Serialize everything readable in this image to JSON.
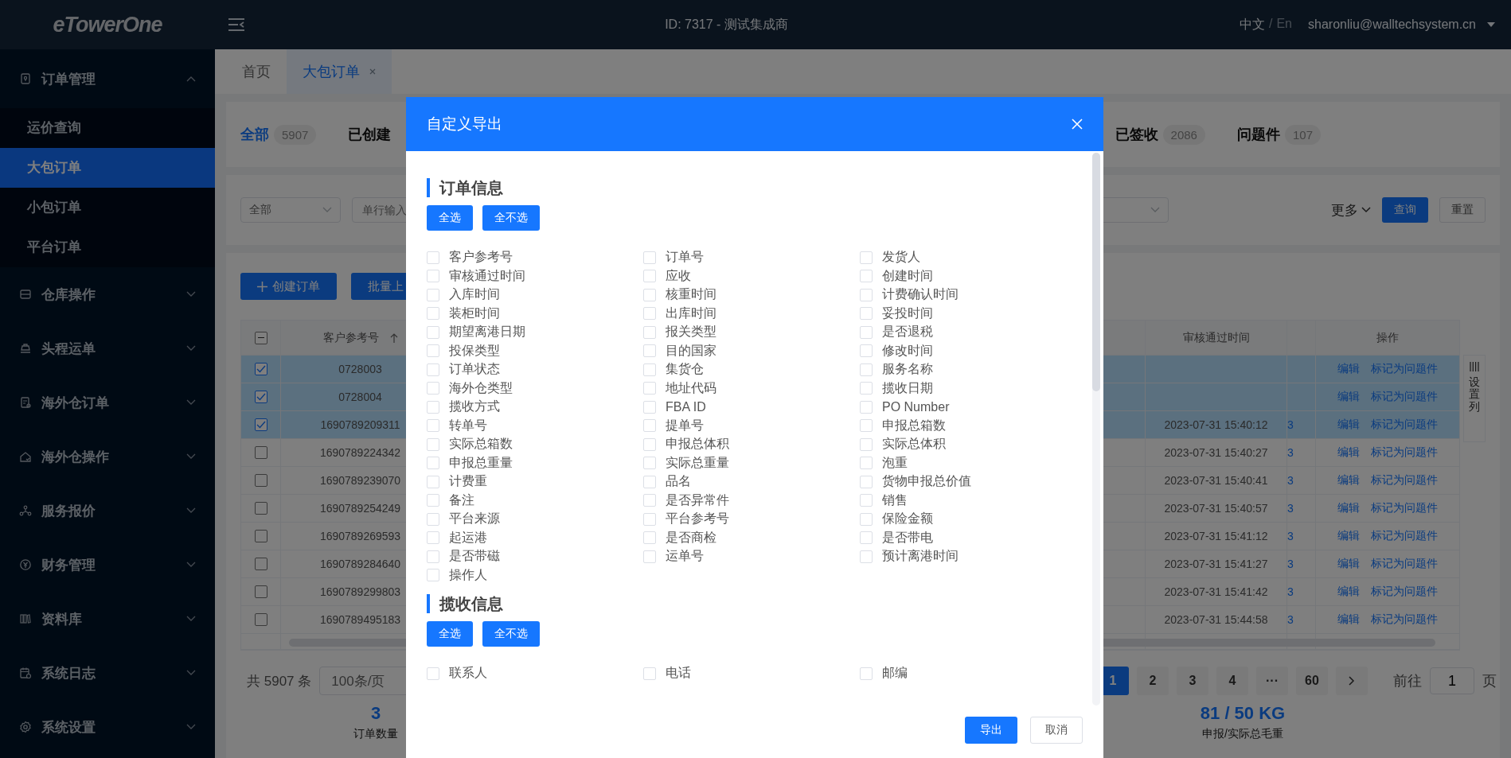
{
  "header": {
    "logo": "eTowerOne",
    "account": "ID: 7317 - 测试集成商",
    "language": [
      {
        "label": "中文",
        "selected": true
      },
      {
        "label": "En",
        "selected": false
      }
    ],
    "language_separator": "/",
    "user": "sharonliu@walltechsystem.cn"
  },
  "sidebar": {
    "items": [
      {
        "label": "订单管理",
        "expanded": true,
        "children": [
          {
            "label": "运价查询",
            "selected": false
          },
          {
            "label": "大包订单",
            "selected": true
          },
          {
            "label": "小包订单",
            "selected": false
          },
          {
            "label": "平台订单",
            "selected": false
          }
        ]
      },
      {
        "label": "仓库操作",
        "expanded": false
      },
      {
        "label": "头程运单",
        "expanded": false
      },
      {
        "label": "海外仓订单",
        "expanded": false
      },
      {
        "label": "海外仓操作",
        "expanded": false
      },
      {
        "label": "服务报价",
        "expanded": false
      },
      {
        "label": "财务管理",
        "expanded": false
      },
      {
        "label": "资料库",
        "expanded": false
      },
      {
        "label": "系统日志",
        "expanded": false
      },
      {
        "label": "系统设置",
        "expanded": false
      }
    ]
  },
  "tabs": [
    {
      "label": "首页",
      "selected": false,
      "closable": false
    },
    {
      "label": "大包订单",
      "selected": true,
      "closable": true
    }
  ],
  "status_tabs": [
    {
      "label": "全部",
      "count": "5907",
      "selected": true
    },
    {
      "label": "已创建",
      "selected": false
    },
    {
      "label": "已签收",
      "count": "2086",
      "selected": false
    },
    {
      "label": "问题件",
      "count": "107",
      "selected": false
    }
  ],
  "filters": {
    "scope": "全部",
    "search_placeholder": "单行输入",
    "more": "更多",
    "query": "查询",
    "reset": "重置"
  },
  "actions": [
    "创建订单",
    "批量上"
  ],
  "table": {
    "header_checkbox_indeterminate": true,
    "columns": [
      "客户参考号",
      "审核通过时间",
      "操作"
    ],
    "rows": [
      {
        "selected": true,
        "customer_ref": "0728003",
        "actions": [
          "编辑",
          "标记为问题件"
        ]
      },
      {
        "selected": true,
        "customer_ref": "0728004",
        "actions": [
          "编辑",
          "标记为问题件"
        ]
      },
      {
        "selected": true,
        "customer_ref": "1690789209311",
        "approved_at": "2023-07-31 15:40:12",
        "column_4": "3",
        "actions": [
          "编辑",
          "标记为问题件"
        ]
      },
      {
        "selected": false,
        "customer_ref": "1690789224342",
        "approved_at": "2023-07-31 15:40:27",
        "column_4": "3",
        "actions": [
          "编辑",
          "标记为问题件"
        ]
      },
      {
        "selected": false,
        "customer_ref": "1690789239070",
        "approved_at": "2023-07-31 15:40:41",
        "column_4": "3",
        "actions": [
          "编辑",
          "标记为问题件"
        ]
      },
      {
        "selected": false,
        "customer_ref": "1690789254249",
        "approved_at": "2023-07-31 15:40:57",
        "column_4": "3",
        "actions": [
          "编辑",
          "标记为问题件"
        ]
      },
      {
        "selected": false,
        "customer_ref": "1690789269593",
        "approved_at": "2023-07-31 15:41:12",
        "column_4": "3",
        "actions": [
          "编辑",
          "标记为问题件"
        ]
      },
      {
        "selected": false,
        "customer_ref": "1690789284640",
        "approved_at": "2023-07-31 15:41:27",
        "column_4": "3",
        "actions": [
          "编辑",
          "标记为问题件"
        ]
      },
      {
        "selected": false,
        "customer_ref": "1690789299803",
        "approved_at": "2023-07-31 15:41:42",
        "column_4": "3",
        "actions": [
          "编辑",
          "标记为问题件"
        ]
      },
      {
        "selected": false,
        "customer_ref": "1690789495183",
        "approved_at": "2023-07-31 15:44:58",
        "column_4": "3",
        "actions": [
          "编辑",
          "标记为问题件"
        ]
      }
    ],
    "column_settings": "设置列"
  },
  "pagination": {
    "total": "共 5907 条",
    "page_size": "100条/页",
    "pages": [
      {
        "label": "1",
        "selected": true
      },
      {
        "label": "2",
        "selected": false
      },
      {
        "label": "3",
        "selected": false
      },
      {
        "label": "4",
        "selected": false
      },
      {
        "label": "···",
        "selected": false
      },
      {
        "label": "60",
        "selected": false
      }
    ],
    "goto_label": "前往",
    "goto_value": "1",
    "goto_suffix": "页"
  },
  "summary": [
    {
      "value": "3",
      "label": "订单数量"
    },
    {
      "value": "81 / 50 KG",
      "label": "申报/实际总毛重"
    }
  ],
  "dialog": {
    "title": "自定义导出",
    "sections": [
      {
        "title": "订单信息",
        "select_all": "全选",
        "select_none": "全不选",
        "fields": [
          {
            "label": "客户参考号",
            "checked": false
          },
          {
            "label": "订单号",
            "checked": false
          },
          {
            "label": "发货人",
            "checked": false
          },
          {
            "label": "审核通过时间",
            "checked": false
          },
          {
            "label": "应收",
            "checked": false
          },
          {
            "label": "创建时间",
            "checked": false
          },
          {
            "label": "入库时间",
            "checked": false
          },
          {
            "label": "核重时间",
            "checked": false
          },
          {
            "label": "计费确认时间",
            "checked": false
          },
          {
            "label": "装柜时间",
            "checked": false
          },
          {
            "label": "出库时间",
            "checked": false
          },
          {
            "label": "妥投时间",
            "checked": false
          },
          {
            "label": "期望离港日期",
            "checked": false
          },
          {
            "label": "报关类型",
            "checked": false
          },
          {
            "label": "是否退税",
            "checked": false
          },
          {
            "label": "投保类型",
            "checked": false
          },
          {
            "label": "目的国家",
            "checked": false
          },
          {
            "label": "修改时间",
            "checked": false
          },
          {
            "label": "订单状态",
            "checked": false
          },
          {
            "label": "集货仓",
            "checked": false
          },
          {
            "label": "服务名称",
            "checked": false
          },
          {
            "label": "海外仓类型",
            "checked": false
          },
          {
            "label": "地址代码",
            "checked": false
          },
          {
            "label": "揽收日期",
            "checked": false
          },
          {
            "label": "揽收方式",
            "checked": false
          },
          {
            "label": "FBA ID",
            "checked": false
          },
          {
            "label": "PO Number",
            "checked": false
          },
          {
            "label": "转单号",
            "checked": false
          },
          {
            "label": "提单号",
            "checked": false
          },
          {
            "label": "申报总箱数",
            "checked": false
          },
          {
            "label": "实际总箱数",
            "checked": false
          },
          {
            "label": "申报总体积",
            "checked": false
          },
          {
            "label": "实际总体积",
            "checked": false
          },
          {
            "label": "申报总重量",
            "checked": false
          },
          {
            "label": "实际总重量",
            "checked": false
          },
          {
            "label": "泡重",
            "checked": false
          },
          {
            "label": "计费重",
            "checked": false
          },
          {
            "label": "品名",
            "checked": false
          },
          {
            "label": "货物申报总价值",
            "checked": false
          },
          {
            "label": "备注",
            "checked": false
          },
          {
            "label": "是否异常件",
            "checked": false
          },
          {
            "label": "销售",
            "checked": false
          },
          {
            "label": "平台来源",
            "checked": false
          },
          {
            "label": "平台参考号",
            "checked": false
          },
          {
            "label": "保险金额",
            "checked": false
          },
          {
            "label": "起运港",
            "checked": false
          },
          {
            "label": "是否商检",
            "checked": false
          },
          {
            "label": "是否带电",
            "checked": false
          },
          {
            "label": "是否带磁",
            "checked": false
          },
          {
            "label": "运单号",
            "checked": false
          },
          {
            "label": "预计离港时间",
            "checked": false
          },
          {
            "label": "操作人",
            "checked": false
          }
        ]
      },
      {
        "title": "揽收信息",
        "select_all": "全选",
        "select_none": "全不选",
        "fields": [
          {
            "label": "联系人",
            "checked": false
          },
          {
            "label": "电话",
            "checked": false
          },
          {
            "label": "邮编",
            "checked": false
          }
        ]
      }
    ],
    "export": "导出",
    "cancel": "取消"
  }
}
